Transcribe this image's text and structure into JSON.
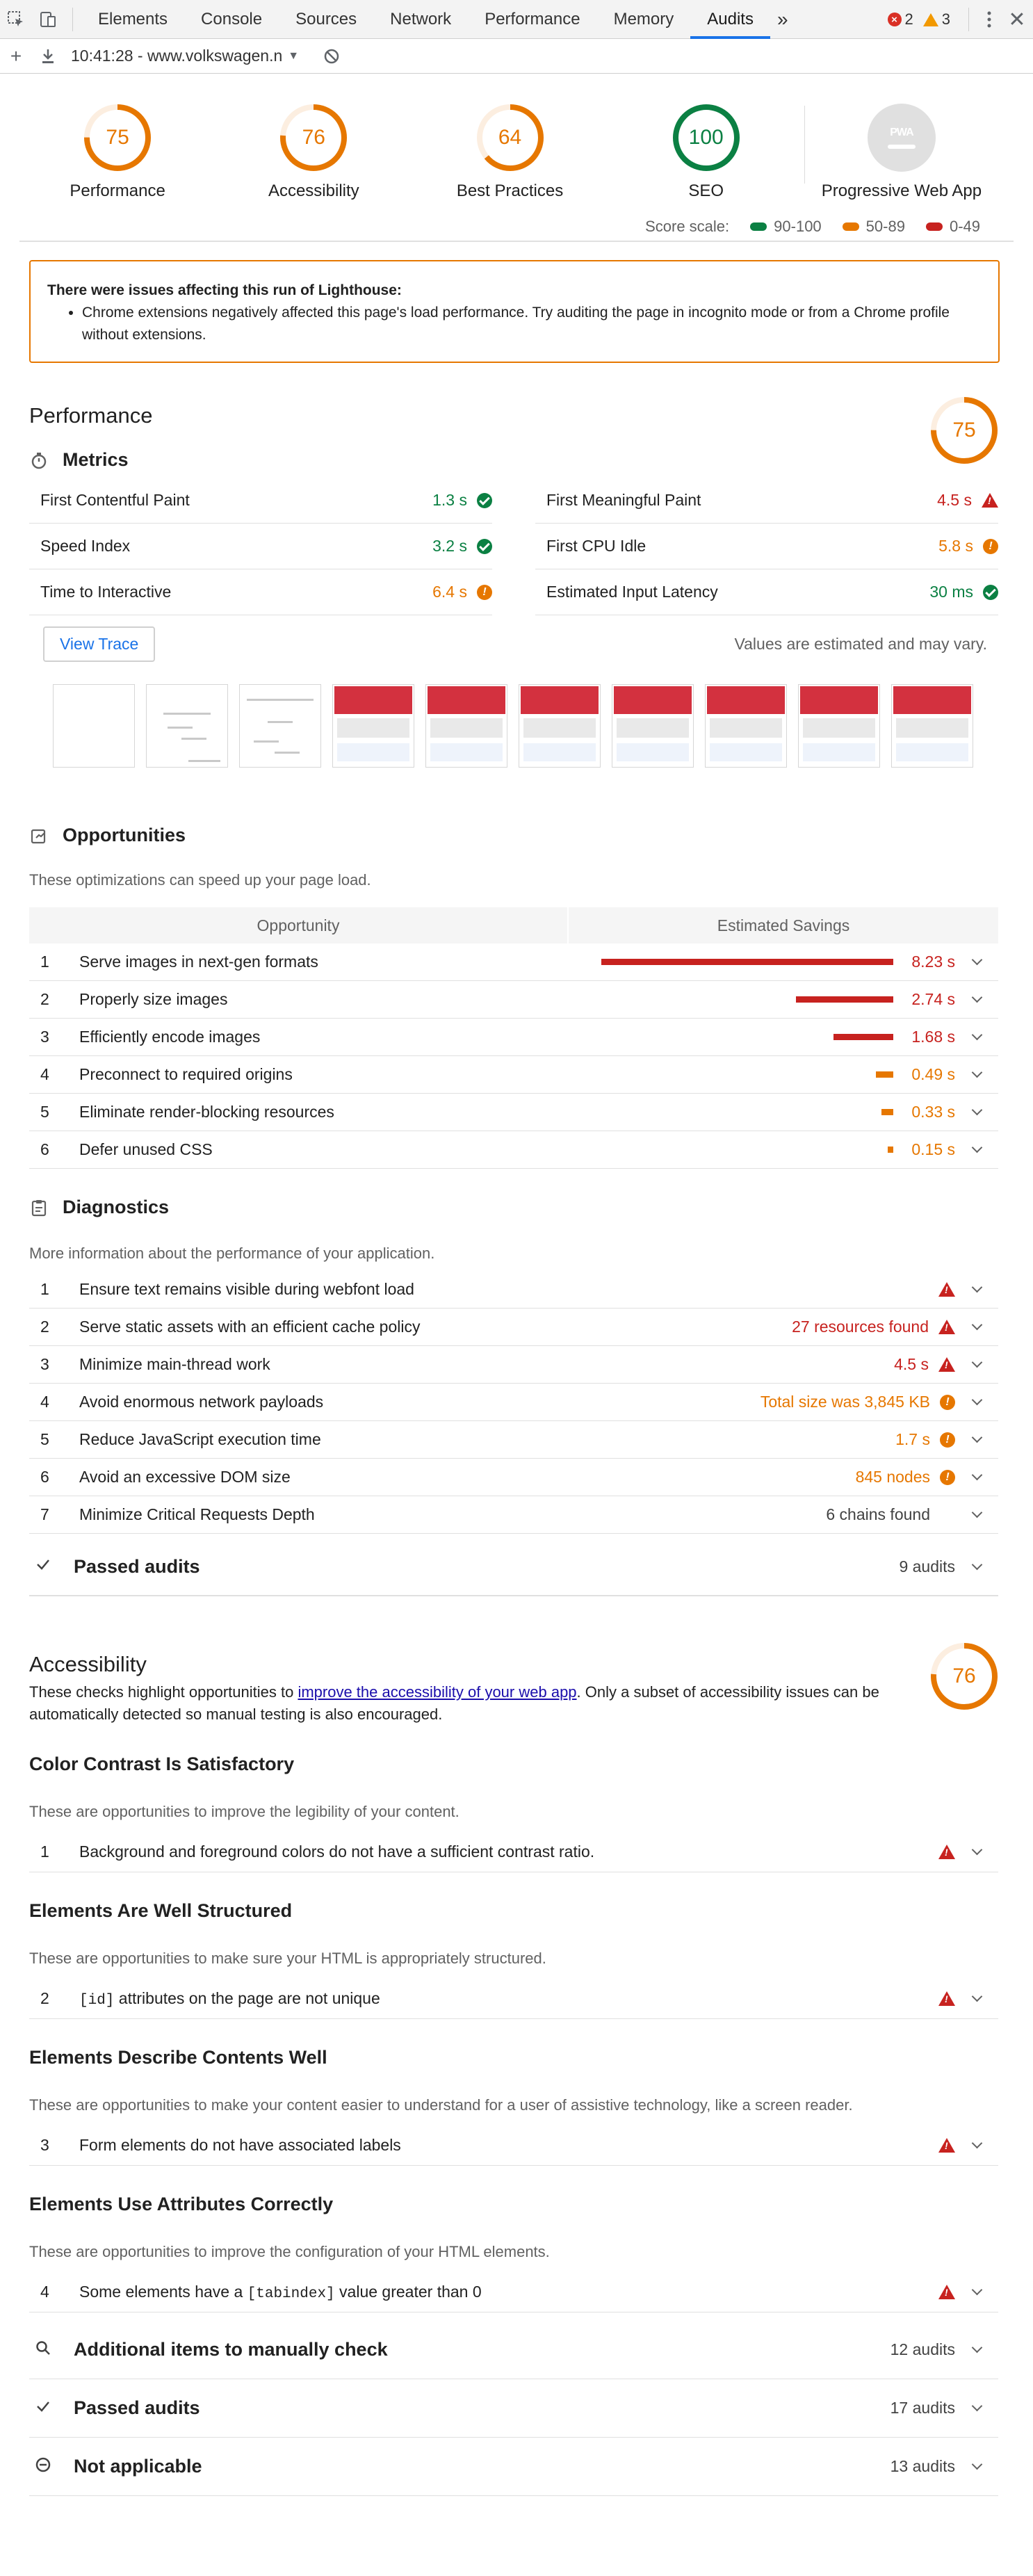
{
  "devtools": {
    "tabs": [
      "Elements",
      "Console",
      "Sources",
      "Network",
      "Performance",
      "Memory",
      "Audits"
    ],
    "active_tab": "Audits",
    "more_tabs": "»",
    "errors_count": "2",
    "warnings_count": "3",
    "url_label": "10:41:28 - www.volkswagen.n"
  },
  "gauges": [
    {
      "label": "Performance",
      "score": "75",
      "value": 75,
      "color": "#e67700"
    },
    {
      "label": "Accessibility",
      "score": "76",
      "value": 76,
      "color": "#e67700"
    },
    {
      "label": "Best Practices",
      "score": "64",
      "value": 64,
      "color": "#e67700"
    },
    {
      "label": "SEO",
      "score": "100",
      "value": 100,
      "color": "#0b8043"
    }
  ],
  "pwa": {
    "label": "Progressive Web App",
    "icon_text": "PWA"
  },
  "score_scale": {
    "label": "Score scale:",
    "items": [
      {
        "range": "90-100",
        "color": "#0b8043"
      },
      {
        "range": "50-89",
        "color": "#e67700"
      },
      {
        "range": "0-49",
        "color": "#c7221f"
      }
    ]
  },
  "warning": {
    "title": "There were issues affecting this run of Lighthouse:",
    "items": [
      "Chrome extensions negatively affected this page's load performance. Try auditing the page in incognito mode or from a Chrome profile without extensions."
    ]
  },
  "performance": {
    "title": "Performance",
    "score": "75",
    "score_value": 75,
    "metrics_title": "Metrics",
    "metrics": [
      {
        "name": "First Contentful Paint",
        "value": "1.3 s",
        "status": "pass"
      },
      {
        "name": "First Meaningful Paint",
        "value": "4.5 s",
        "status": "fail"
      },
      {
        "name": "Speed Index",
        "value": "3.2 s",
        "status": "pass"
      },
      {
        "name": "First CPU Idle",
        "value": "5.8 s",
        "status": "average"
      },
      {
        "name": "Time to Interactive",
        "value": "6.4 s",
        "status": "average"
      },
      {
        "name": "Estimated Input Latency",
        "value": "30 ms",
        "status": "pass"
      }
    ],
    "view_trace": "View Trace",
    "estimate_note": "Values are estimated and may vary.",
    "filmstrip": [
      "blank",
      "partial",
      "partial",
      "loaded",
      "loaded",
      "loaded",
      "loaded",
      "loaded",
      "loaded",
      "loaded"
    ]
  },
  "opportunities": {
    "title": "Opportunities",
    "description": "These optimizations can speed up your page load.",
    "col_opportunity": "Opportunity",
    "col_savings": "Estimated Savings",
    "items": [
      {
        "num": "1",
        "title": "Serve images in next-gen formats",
        "savings": "8.23 s",
        "seconds": 8.23,
        "status": "fail"
      },
      {
        "num": "2",
        "title": "Properly size images",
        "savings": "2.74 s",
        "seconds": 2.74,
        "status": "fail"
      },
      {
        "num": "3",
        "title": "Efficiently encode images",
        "savings": "1.68 s",
        "seconds": 1.68,
        "status": "fail"
      },
      {
        "num": "4",
        "title": "Preconnect to required origins",
        "savings": "0.49 s",
        "seconds": 0.49,
        "status": "average"
      },
      {
        "num": "5",
        "title": "Eliminate render-blocking resources",
        "savings": "0.33 s",
        "seconds": 0.33,
        "status": "average"
      },
      {
        "num": "6",
        "title": "Defer unused CSS",
        "savings": "0.15 s",
        "seconds": 0.15,
        "status": "average"
      }
    ]
  },
  "diagnostics": {
    "title": "Diagnostics",
    "description": "More information about the performance of your application.",
    "items": [
      {
        "num": "1",
        "title": "Ensure text remains visible during webfont load",
        "value": "",
        "status": "fail"
      },
      {
        "num": "2",
        "title": "Serve static assets with an efficient cache policy",
        "value": "27 resources found",
        "status": "fail"
      },
      {
        "num": "3",
        "title": "Minimize main-thread work",
        "value": "4.5 s",
        "status": "fail"
      },
      {
        "num": "4",
        "title": "Avoid enormous network payloads",
        "value": "Total size was 3,845 KB",
        "status": "average"
      },
      {
        "num": "5",
        "title": "Reduce JavaScript execution time",
        "value": "1.7 s",
        "status": "average"
      },
      {
        "num": "6",
        "title": "Avoid an excessive DOM size",
        "value": "845 nodes",
        "status": "average"
      },
      {
        "num": "7",
        "title": "Minimize Critical Requests Depth",
        "value": "6 chains found",
        "status": "info"
      }
    ]
  },
  "perf_passed": {
    "title": "Passed audits",
    "count": "9 audits"
  },
  "accessibility": {
    "title": "Accessibility",
    "score": "76",
    "score_value": 76,
    "description_before": "These checks highlight opportunities to ",
    "description_link": "improve the accessibility of your web app",
    "description_after": ". Only a subset of accessibility issues can be automatically detected so manual testing is also encouraged.",
    "groups": [
      {
        "title": "Color Contrast Is Satisfactory",
        "description": "These are opportunities to improve the legibility of your content.",
        "audit": {
          "num": "1",
          "before": "Background and foreground colors do not have a sufficient contrast ratio.",
          "code": "",
          "after": ""
        }
      },
      {
        "title": "Elements Are Well Structured",
        "description": "These are opportunities to make sure your HTML is appropriately structured.",
        "audit": {
          "num": "2",
          "before": "",
          "code": "[id]",
          "after": " attributes on the page are not unique"
        }
      },
      {
        "title": "Elements Describe Contents Well",
        "description": "These are opportunities to make your content easier to understand for a user of assistive technology, like a screen reader.",
        "audit": {
          "num": "3",
          "before": "Form elements do not have associated labels",
          "code": "",
          "after": ""
        }
      },
      {
        "title": "Elements Use Attributes Correctly",
        "description": "These are opportunities to improve the configuration of your HTML elements.",
        "audit": {
          "num": "4",
          "before": "Some elements have a ",
          "code": "[tabindex]",
          "after": " value greater than 0"
        }
      }
    ],
    "manual": {
      "title": "Additional items to manually check",
      "count": "12 audits"
    },
    "passed": {
      "title": "Passed audits",
      "count": "17 audits"
    },
    "not_applicable": {
      "title": "Not applicable",
      "count": "13 audits"
    }
  }
}
